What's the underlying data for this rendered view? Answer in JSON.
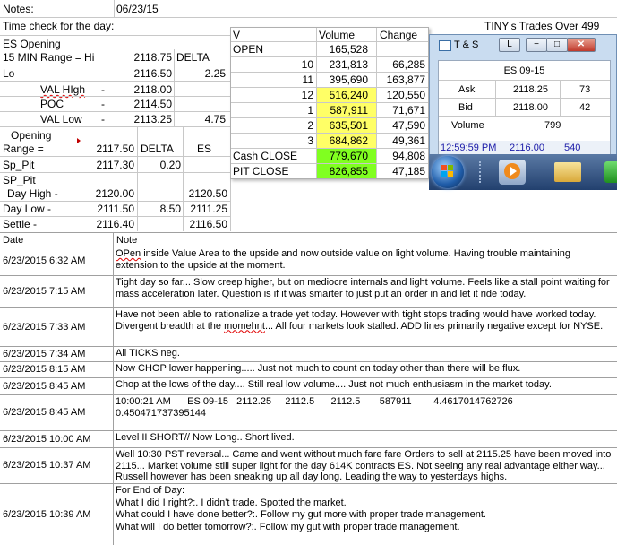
{
  "header": {
    "notes_label": "Notes:",
    "date": "06/23/15",
    "time_check": "Time check for the day:",
    "tiny_trades": "TINY's Trades Over 499"
  },
  "levels": {
    "es_opening": "ES Opening",
    "range_label": "15 MIN Range = Hi",
    "range_hi": "2118.75",
    "delta_label": "DELTA",
    "lo_label": "Lo",
    "lo_value": "2116.50",
    "lo_delta": "2.25",
    "val_high_label": "VAL HIgh",
    "val_high_dash": "-",
    "val_high_value": "2118.00",
    "poc_label": "POC",
    "poc_dash": "-",
    "poc_value": "2114.50",
    "val_low_label": "VAL Low",
    "val_low_dash": "-",
    "val_low_value": "2113.25",
    "val_low_delta": "4.75"
  },
  "opening_range": {
    "label1": "Opening",
    "label2": "Range =",
    "value": "2117.50",
    "delta_label": "DELTA",
    "es_label": "ES",
    "sp_pit_label": "Sp_Pit",
    "sp_pit_value": "2117.30",
    "sp_pit_delta": "0.20",
    "sp_pit2_label": "SP_Pit",
    "day_high_label": "Day High -",
    "day_high_value": "2120.00",
    "day_high_es": "2120.50",
    "day_low_label": "Day Low -",
    "day_low_value": "2111.50",
    "day_low_delta": "8.50",
    "day_low_es": "2111.25",
    "settle_label": "Settle -",
    "settle_value": "2116.40",
    "settle_es": "2116.50"
  },
  "volume_table": {
    "headers": [
      "V",
      "Volume",
      "Change"
    ],
    "rows": [
      {
        "label": "OPEN",
        "volume": "165,528",
        "change": ""
      },
      {
        "label": "10",
        "volume": "231,813",
        "change": "66,285"
      },
      {
        "label": "11",
        "volume": "395,690",
        "change": "163,877"
      },
      {
        "label": "12",
        "volume": "516,240",
        "change": "120,550"
      },
      {
        "label": "1",
        "volume": "587,911",
        "change": "71,671"
      },
      {
        "label": "2",
        "volume": "635,501",
        "change": "47,590"
      },
      {
        "label": "3",
        "volume": "684,862",
        "change": "49,361"
      },
      {
        "label": "Cash CLOSE",
        "volume": "779,670",
        "change": "94,808"
      },
      {
        "label": "PIT CLOSE",
        "volume": "826,855",
        "change": "47,185"
      }
    ],
    "colors": {
      "yellow": "#ffff66",
      "green": "#80ff20"
    }
  },
  "ts_window": {
    "title": "T & S",
    "btn_l": "L",
    "symbol": "ES 09-15",
    "ask_label": "Ask",
    "ask_price": "2118.25",
    "ask_size": "73",
    "bid_label": "Bid",
    "bid_price": "2118.00",
    "bid_size": "42",
    "volume_label": "Volume",
    "volume_value": "799",
    "last_time": "12:59:59 PM",
    "last_price": "2116.00",
    "last_size": "540"
  },
  "notes_table": {
    "date_header": "Date",
    "note_header": "Note",
    "rows": [
      {
        "date": "6/23/2015 6:32 AM",
        "note_first": "OPen",
        "note": " inside Value Area to the upside and now outside value on light volume.  Having trouble maintaining extension to the upside at the moment."
      },
      {
        "date": "6/23/2015 7:15 AM",
        "note": "Tight day so far... Slow creep higher, but on mediocre internals and light volume.  Feels like a stall point waiting for mass acceleration later.  Question is if it was smarter to just put an order in and let it ride today."
      },
      {
        "date": "6/23/2015 7:33 AM",
        "note_a": "Have not been able to rationalize a trade yet today.  However with tight stops trading would have worked today.  Divergent breadth at the ",
        "note_b": "momehnt",
        "note_c": "...  All four markets look stalled.  ADD lines primarily negative except for NYSE."
      },
      {
        "date": "6/23/2015 7:34 AM",
        "note": "All TICKS neg."
      },
      {
        "date": "6/23/2015 8:15 AM",
        "note": "Now CHOP lower happening..... Just not much to count on today other than there will be flux."
      },
      {
        "date": "6/23/2015 8:45 AM",
        "note": "Chop at the lows of the day.... Still real low volume.... Just not much enthusiasm in the market today."
      },
      {
        "date": "6/23/2015 8:45 AM",
        "note_l1": "10:00:21 AM      ES 09-15   2112.25     2112.5      2112.5       587911        4.4617014762726",
        "note_l2": "0.450471737395144"
      },
      {
        "date": "6/23/2015 10:00 AM",
        "note": "Level II SHORT// Now Long.. Short lived."
      },
      {
        "date": "6/23/2015 10:37 AM",
        "note": "Well 10:30 PST reversal... Came and went without much fare fare  Orders to sell at 2115.25 have been moved into 2115... Market volume still super light for the day 614K contracts ES.  Not seeing any real advantage either way... Russell however has been sneaking up all day long.  Leading the way to yesterdays highs."
      },
      {
        "date": "6/23/2015 10:39 AM",
        "lines": [
          "For End of Day:",
          "What I did I right?:.  I didn't trade.  Spotted the market.",
          "What could I have done better?:.  Follow my gut more with proper trade management.",
          "What will I do better tomorrow?:.  Follow my gut with proper trade management."
        ]
      }
    ]
  }
}
